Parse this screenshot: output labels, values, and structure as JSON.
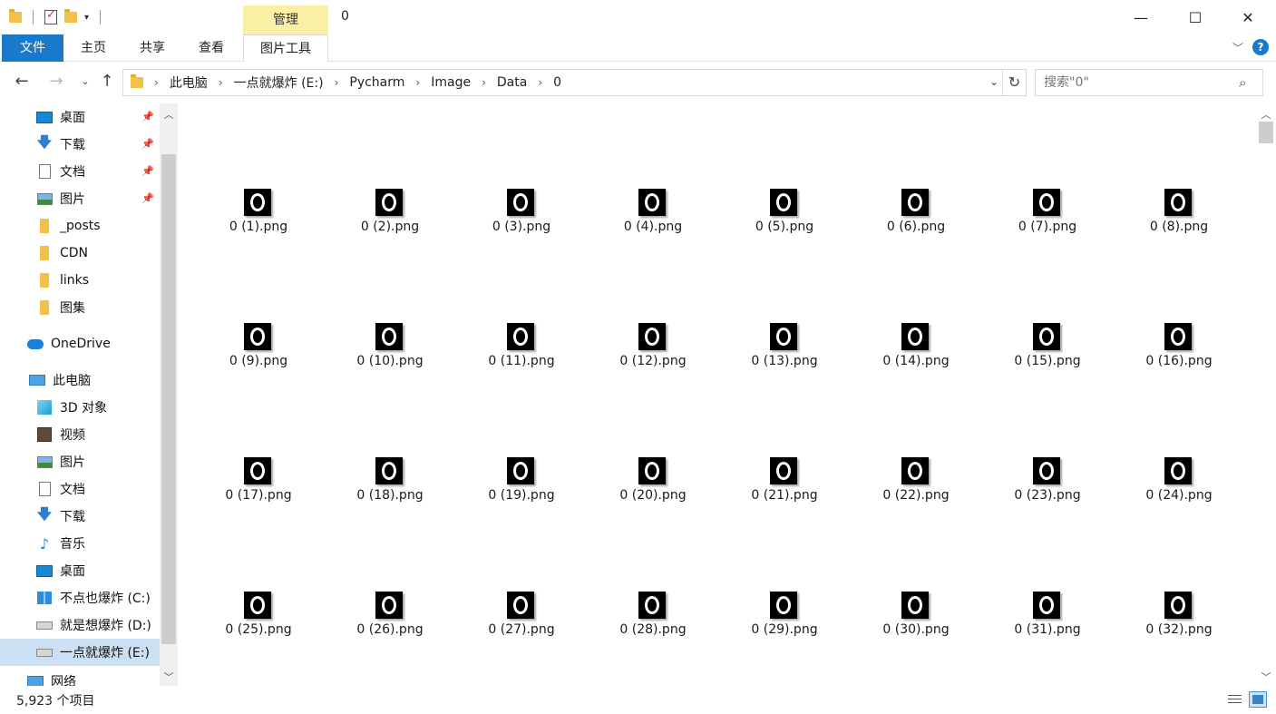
{
  "window": {
    "title": "0",
    "manage_tab": "管理",
    "minimize": "—",
    "maximize": "☐",
    "close": "✕"
  },
  "ribbon": {
    "tabs": [
      "文件",
      "主页",
      "共享",
      "查看",
      "图片工具"
    ],
    "help": "?"
  },
  "address": {
    "crumbs": [
      "此电脑",
      "一点就爆炸 (E:)",
      "Pycharm",
      "Image",
      "Data",
      "0"
    ],
    "search_placeholder": "搜索\"0\""
  },
  "sidebar": {
    "items": [
      {
        "label": "桌面",
        "icon": "desktop-icon",
        "pinned": true
      },
      {
        "label": "下载",
        "icon": "download-icon",
        "pinned": true
      },
      {
        "label": "文档",
        "icon": "document-icon",
        "pinned": true
      },
      {
        "label": "图片",
        "icon": "picture-icon",
        "pinned": true
      },
      {
        "label": "_posts",
        "icon": "folder-icon"
      },
      {
        "label": "CDN",
        "icon": "folder-icon"
      },
      {
        "label": "links",
        "icon": "folder-icon"
      },
      {
        "label": "图集",
        "icon": "folder-icon"
      },
      {
        "label": "OneDrive",
        "icon": "onedrive-icon"
      },
      {
        "label": "此电脑",
        "icon": "this-pc-icon"
      },
      {
        "label": "3D 对象",
        "icon": "3d-objects-icon"
      },
      {
        "label": "视频",
        "icon": "video-icon"
      },
      {
        "label": "图片",
        "icon": "picture-icon"
      },
      {
        "label": "文档",
        "icon": "document-icon"
      },
      {
        "label": "下载",
        "icon": "download-icon"
      },
      {
        "label": "音乐",
        "icon": "music-icon"
      },
      {
        "label": "桌面",
        "icon": "desktop-icon"
      },
      {
        "label": "不点也爆炸 (C:)",
        "icon": "windows-drive-icon"
      },
      {
        "label": "就是想爆炸 (D:)",
        "icon": "drive-icon"
      },
      {
        "label": "一点就爆炸 (E:)",
        "icon": "drive-icon",
        "selected": true
      },
      {
        "label": "网络",
        "icon": "network-icon"
      }
    ]
  },
  "files": [
    "0 (1).png",
    "0 (2).png",
    "0 (3).png",
    "0 (4).png",
    "0 (5).png",
    "0 (6).png",
    "0 (7).png",
    "0 (8).png",
    "0 (9).png",
    "0 (10).png",
    "0 (11).png",
    "0 (12).png",
    "0 (13).png",
    "0 (14).png",
    "0 (15).png",
    "0 (16).png",
    "0 (17).png",
    "0 (18).png",
    "0 (19).png",
    "0 (20).png",
    "0 (21).png",
    "0 (22).png",
    "0 (23).png",
    "0 (24).png",
    "0 (25).png",
    "0 (26).png",
    "0 (27).png",
    "0 (28).png",
    "0 (29).png",
    "0 (30).png",
    "0 (31).png",
    "0 (32).png"
  ],
  "status": {
    "item_count": "5,923 个项目"
  }
}
